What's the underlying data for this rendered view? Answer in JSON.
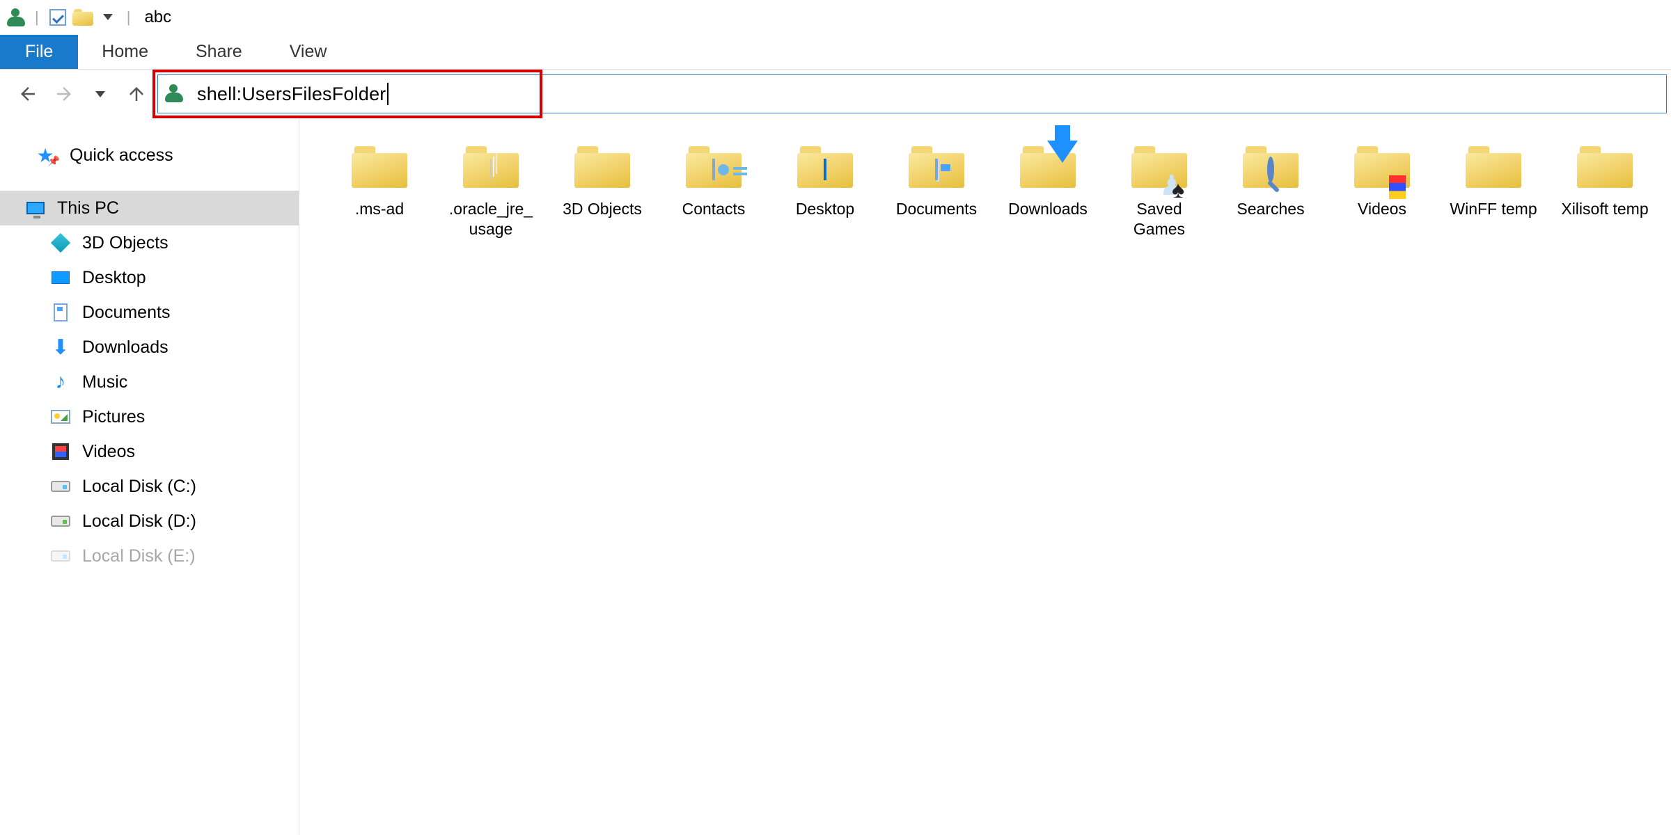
{
  "window": {
    "title": "abc"
  },
  "ribbon": {
    "file": "File",
    "tabs": [
      "Home",
      "Share",
      "View"
    ]
  },
  "addressbar": {
    "text": "shell:UsersFilesFolder"
  },
  "tree": {
    "quick_access": "Quick access",
    "this_pc": "This PC",
    "children": [
      {
        "label": "3D Objects"
      },
      {
        "label": "Desktop"
      },
      {
        "label": "Documents"
      },
      {
        "label": "Downloads"
      },
      {
        "label": "Music"
      },
      {
        "label": "Pictures"
      },
      {
        "label": "Videos"
      },
      {
        "label": "Local Disk (C:)"
      },
      {
        "label": "Local Disk (D:)"
      },
      {
        "label": "Local Disk (E:)"
      }
    ]
  },
  "items": [
    {
      "label": ".ms-ad",
      "icon": "folder"
    },
    {
      "label": ".oracle_jre_usage",
      "icon": "folder-paper"
    },
    {
      "label": "3D Objects",
      "icon": "folder-cube"
    },
    {
      "label": "Contacts",
      "icon": "folder-card"
    },
    {
      "label": "Desktop",
      "icon": "folder-monitor"
    },
    {
      "label": "Documents",
      "icon": "folder-page"
    },
    {
      "label": "Downloads",
      "icon": "folder-download"
    },
    {
      "label": "Saved Games",
      "icon": "folder-games"
    },
    {
      "label": "Searches",
      "icon": "folder-search"
    },
    {
      "label": "Videos",
      "icon": "folder-film"
    },
    {
      "label": "WinFF temp",
      "icon": "folder"
    },
    {
      "label": "Xilisoft temp",
      "icon": "folder"
    }
  ]
}
